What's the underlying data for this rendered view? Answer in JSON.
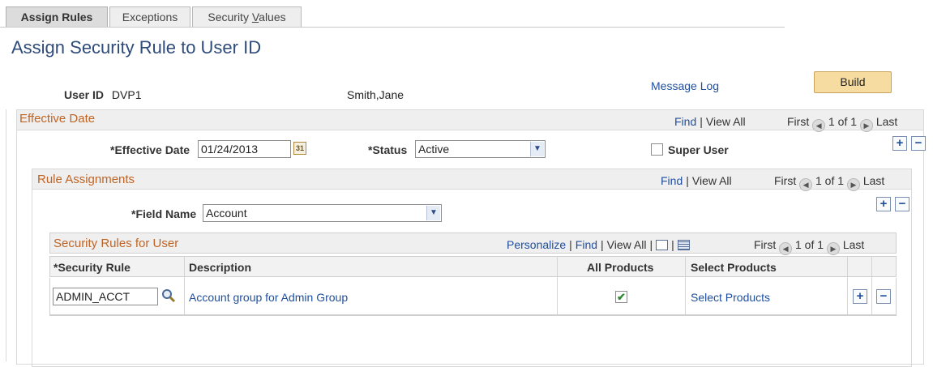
{
  "tabs": [
    {
      "label": "Assign Rules",
      "active": true
    },
    {
      "label": "Exceptions",
      "active": false
    },
    {
      "label_pre": "Security ",
      "label_accel": "V",
      "label_post": "alues",
      "active": false
    }
  ],
  "page_title": "Assign Security Rule to User ID",
  "header": {
    "user_id_label": "User ID",
    "user_id_value": "DVP1",
    "user_name": "Smith,Jane",
    "message_log": "Message Log",
    "build_label": "Build"
  },
  "effective_date_box": {
    "title": "Effective Date",
    "find": "Find",
    "view_all": "View All",
    "first": "First",
    "count": "1 of 1",
    "last": "Last",
    "eff_date_label": "*Effective Date",
    "eff_date_value": "01/24/2013",
    "status_label": "*Status",
    "status_value": "Active",
    "super_user_label": "Super User",
    "super_user_checked": false
  },
  "rule_assignments": {
    "title": "Rule Assignments",
    "find": "Find",
    "view_all": "View All",
    "first": "First",
    "count": "1 of 1",
    "last": "Last",
    "field_name_label": "*Field Name",
    "field_name_value": "Account"
  },
  "security_rules": {
    "title": "Security Rules for User",
    "personalize": "Personalize",
    "find": "Find",
    "view_all": "View All",
    "first": "First",
    "count": "1 of 1",
    "last": "Last",
    "columns": [
      "*Security Rule",
      "Description",
      "All Products",
      "Select Products"
    ],
    "rows": [
      {
        "security_rule": "ADMIN_ACCT",
        "description": "Account group for Admin Group",
        "all_products": true,
        "select_products": "Select Products"
      }
    ]
  },
  "icons": {
    "plus": "+",
    "minus": "−",
    "calendar": "31",
    "dropdown": "▼",
    "prev": "◀",
    "next": "▶",
    "check": "✔"
  },
  "colors": {
    "link": "#1f4e9c",
    "group_title": "#c06424",
    "page_title": "#2f4b7a",
    "build_button": "#f6dca0"
  }
}
